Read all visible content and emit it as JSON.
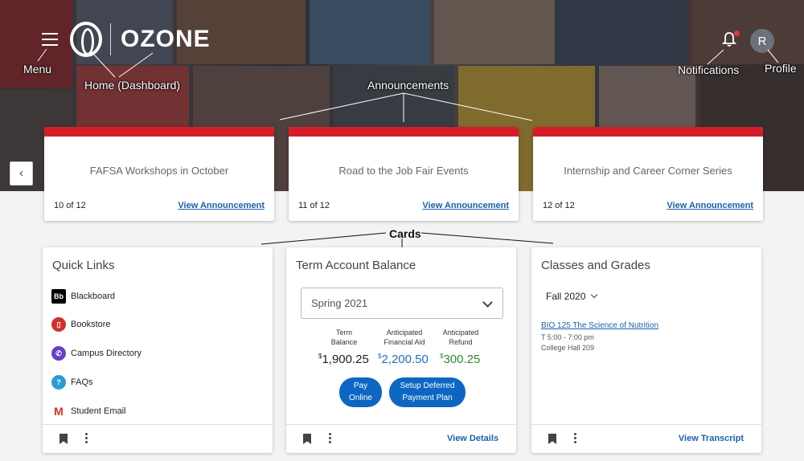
{
  "header": {
    "logo_text": "OZONE",
    "avatar_initial": "R"
  },
  "annotations": {
    "menu": "Menu",
    "home": "Home (Dashboard)",
    "announcements": "Announcements",
    "notifications": "Notifications",
    "profile": "Profile",
    "cards": "Cards"
  },
  "announcements": [
    {
      "title": "FAFSA Workshops in October",
      "count": "10 of 12",
      "link": "View Announcement"
    },
    {
      "title": "Road to the Job Fair Events",
      "count": "11 of 12",
      "link": "View Announcement"
    },
    {
      "title": "Internship and Career Corner Series",
      "count": "12 of 12",
      "link": "View Announcement"
    }
  ],
  "quick_links": {
    "title": "Quick Links",
    "items": [
      {
        "label": "Blackboard",
        "icon": "blackboard-icon",
        "color": "#000000",
        "glyph": "Bb"
      },
      {
        "label": "Bookstore",
        "icon": "bookstore-icon",
        "color": "#d32f2f",
        "glyph": "📖"
      },
      {
        "label": "Campus Directory",
        "icon": "phone-icon",
        "color": "#6a3fc8",
        "glyph": "✆"
      },
      {
        "label": "FAQs",
        "icon": "faq-icon",
        "color": "#2b9bd8",
        "glyph": "?"
      },
      {
        "label": "Student Email",
        "icon": "email-icon",
        "color": "#d93025",
        "glyph": "M"
      }
    ]
  },
  "term_balance": {
    "title": "Term Account Balance",
    "selected_term": "Spring 2021",
    "columns": [
      {
        "label_line1": "Term",
        "label_line2": "Balance",
        "value": "1,900.25",
        "color": "#222222"
      },
      {
        "label_line1": "Anticipated",
        "label_line2": "Financial Aid",
        "value": "2,200.50",
        "color": "#1a70c8"
      },
      {
        "label_line1": "Anticipated",
        "label_line2": "Refund",
        "value": "300.25",
        "color": "#2e8b2e"
      }
    ],
    "currency_symbol": "$",
    "pay_button": {
      "line1": "Pay",
      "line2": "Online"
    },
    "plan_button": {
      "line1": "Setup Deferred",
      "line2": "Payment Plan"
    },
    "footer_link": "View Details"
  },
  "classes": {
    "title": "Classes and Grades",
    "term": "Fall 2020",
    "course": {
      "name": "BIO 125 The Science of Nutrition",
      "time": "T 5:00 - 7:00 pm",
      "location": "College Hall 209"
    },
    "footer_link": "View Transcript"
  },
  "colors": {
    "accent_red": "#d31e2a",
    "link_blue": "#1c5fb0",
    "button_blue": "#0d66c2"
  }
}
